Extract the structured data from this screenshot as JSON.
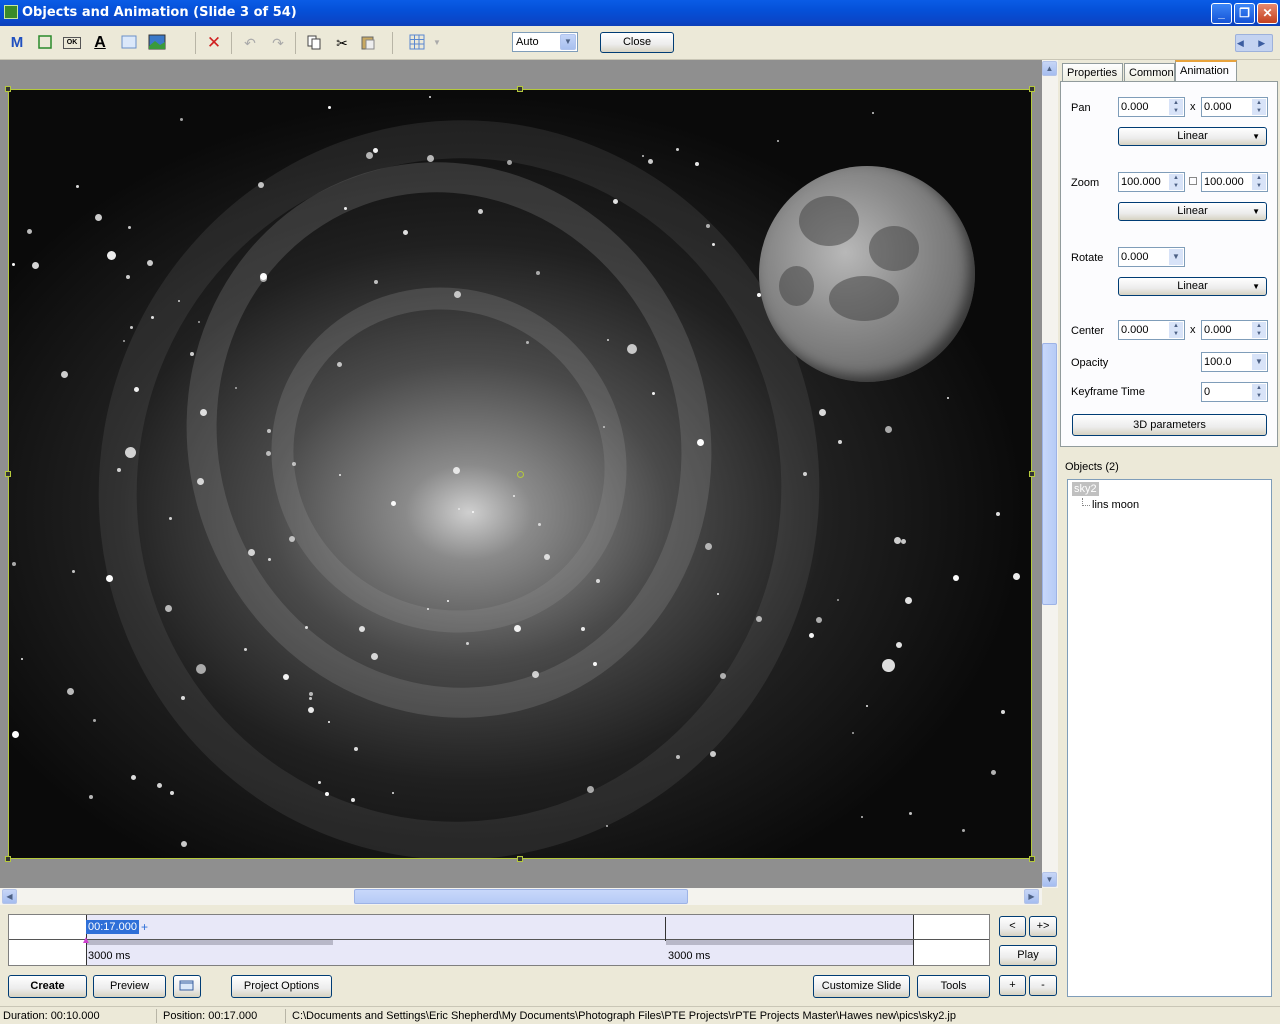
{
  "window": {
    "title": "Objects and Animation  (Slide 3 of 54)",
    "min": "_",
    "max": "❐",
    "close": "✕"
  },
  "toolbar": {
    "icons": [
      "m-icon",
      "rect-icon",
      "ok-icon",
      "text-icon",
      "frame-icon",
      "image-icon",
      "delete-icon",
      "undo-icon",
      "redo-icon",
      "copy-icon",
      "cut-icon",
      "paste-icon",
      "grid-icon"
    ],
    "zoom_value": "Auto",
    "close_label": "Close",
    "nav": "◀ ▶"
  },
  "tabs": [
    "Properties",
    "Common",
    "Animation"
  ],
  "animation": {
    "pan_label": "Pan",
    "pan_x": "0.000",
    "pan_y": "0.000",
    "pan_mode": "Linear",
    "zoom_label": "Zoom",
    "zoom_x": "100.000",
    "zoom_y": "100.000",
    "zoom_mode": "Linear",
    "rotate_label": "Rotate",
    "rotate": "0.000",
    "rotate_mode": "Linear",
    "center_label": "Center",
    "center_x": "0.000",
    "center_y": "0.000",
    "opacity_label": "Opacity",
    "opacity": "100.0",
    "keyframe_label": "Keyframe Time",
    "keyframe": "0",
    "params_button": "3D parameters",
    "x": "x"
  },
  "objects": {
    "label": "Objects (2)",
    "items": [
      "sky2",
      "lins moon"
    ]
  },
  "timeline": {
    "position": "00:17.000",
    "plus": "+",
    "seg1": "3000 ms",
    "seg2": "3000 ms"
  },
  "side_buttons": {
    "prev": "<",
    "next": "+>",
    "play": "Play",
    "add": "+",
    "remove": "-"
  },
  "bottom_buttons": {
    "create": "Create",
    "preview": "Preview",
    "project_options": "Project Options",
    "customize_slide": "Customize Slide",
    "tools": "Tools"
  },
  "status": {
    "duration": "Duration:  00:10.000",
    "position": "Position:  00:17.000",
    "path": "C:\\Documents and Settings\\Eric  Shepherd\\My Documents\\Photograph Files\\PTE Projects\\rPTE Projects Master\\Hawes new\\pics\\sky2.jp"
  }
}
